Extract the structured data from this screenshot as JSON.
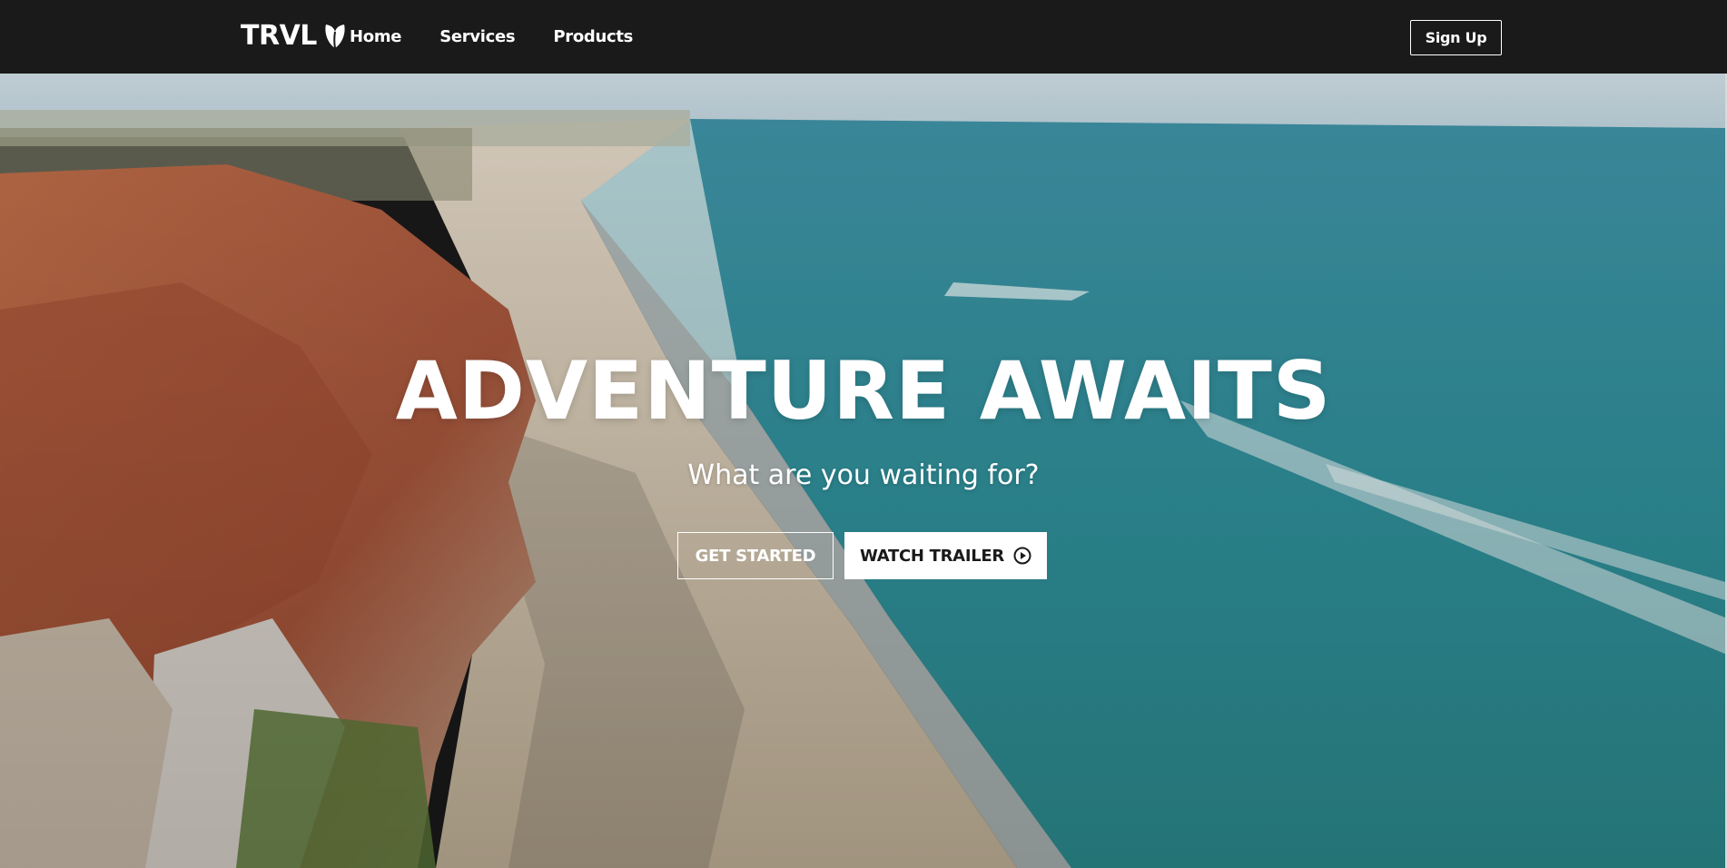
{
  "navbar": {
    "logo_text": "TRVL",
    "logo_icon": "typo3-shield-icon",
    "links": [
      "Home",
      "Services",
      "Products"
    ],
    "signup_label": "Sign Up"
  },
  "hero": {
    "title": "ADVENTURE AWAITS",
    "subtitle": "What are you waiting for?",
    "get_started_label": "GET STARTED",
    "watch_trailer_label": "WATCH TRAILER",
    "watch_trailer_icon": "play-circle-icon",
    "background": "aerial-beach-cliffs-image"
  },
  "colors": {
    "navbar_bg": "#1b1a1a",
    "text": "#ffffff",
    "ocean": "#2f8f9c",
    "sand": "#c9b79b",
    "cliffs": "#b5603c"
  }
}
